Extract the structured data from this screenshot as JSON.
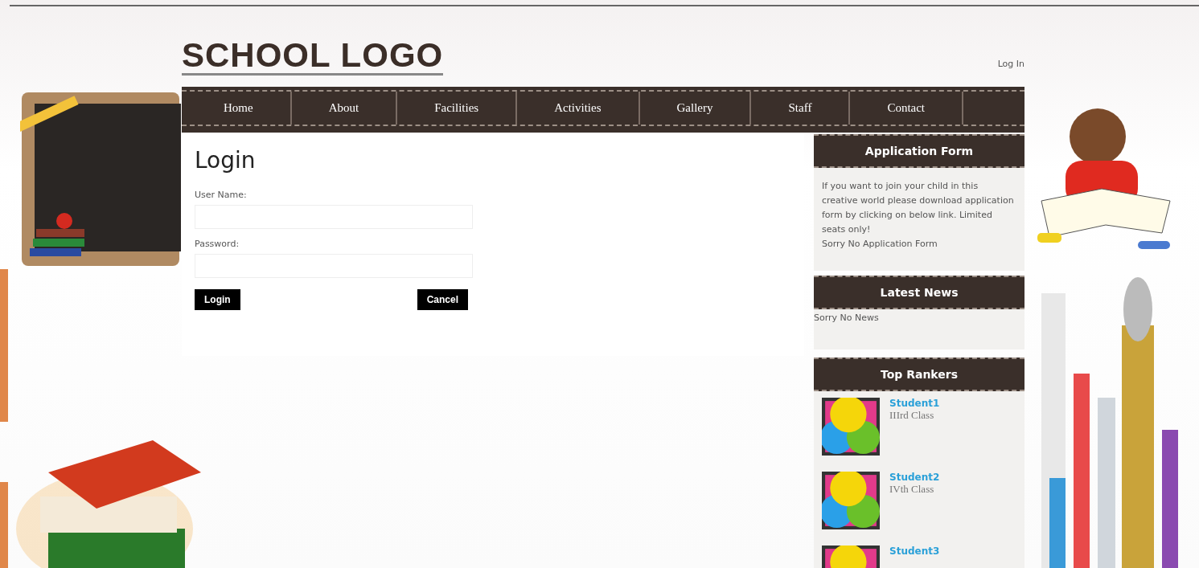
{
  "logo": {
    "text": "SCHOOL LOGO"
  },
  "login_link": "Log In",
  "nav": [
    "Home",
    "About",
    "Facilities",
    "Activities",
    "Gallery",
    "Staff",
    "Contact"
  ],
  "login": {
    "title": "Login",
    "fields": [
      {
        "label": "User Name:"
      },
      {
        "label": "Password:"
      }
    ],
    "buttons": [
      "Login",
      "Cancel"
    ]
  },
  "sidebar": {
    "application_form": {
      "title": "Application Form",
      "text": "If you want to join your child in this creative world please download application form by clicking on below link. Limited seats only!",
      "note": "Sorry No Application Form"
    },
    "latest_news": {
      "title": "Latest News",
      "text": "Sorry No News"
    },
    "top_rankers": {
      "title": "Top Rankers",
      "students": [
        {
          "name": "Student1",
          "class": "IIIrd Class"
        },
        {
          "name": "Student2",
          "class": "IVth Class"
        },
        {
          "name": "Student3"
        }
      ]
    }
  }
}
